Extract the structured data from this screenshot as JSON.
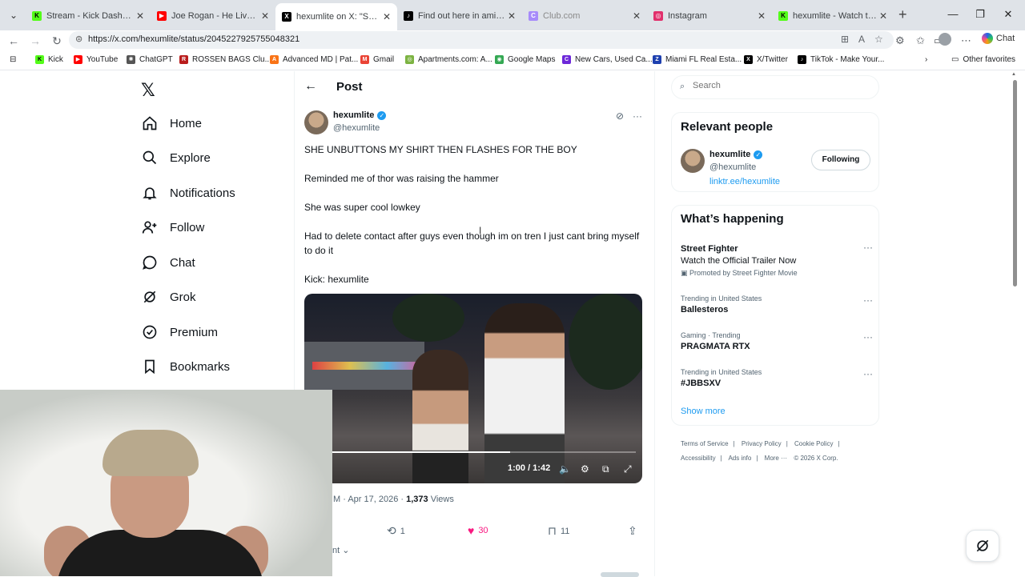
{
  "browser": {
    "tabs": [
      {
        "label": "Stream - Kick Dashboard",
        "fav_color": "#53fc18",
        "fav_text": "K"
      },
      {
        "label": "Joe Rogan - He Lived With N",
        "fav_color": "#ff0000",
        "fav_text": "▶"
      },
      {
        "label": "hexumlite on X: \"SHE UNBU",
        "fav_color": "#000000",
        "fav_text": "X",
        "active": true
      },
      {
        "label": "Find out here in amish doin",
        "fav_color": "#000000",
        "fav_text": "♪"
      },
      {
        "label": "Club.com",
        "fav_color": "#a78bfa",
        "fav_text": "C"
      },
      {
        "label": "Instagram",
        "fav_color": "#e1306c",
        "fav_text": "◎"
      },
      {
        "label": "hexumlite - Watch the VOD",
        "fav_color": "#53fc18",
        "fav_text": "K"
      }
    ],
    "url": "https://x.com/hexumlite/status/2045227925755048321",
    "chat_label": "Chat",
    "bookmarks": [
      {
        "label": "Kick",
        "color": "#53fc18",
        "glyph": "K"
      },
      {
        "label": "YouTube",
        "color": "#ff0000",
        "glyph": "▶"
      },
      {
        "label": "ChatGPT",
        "color": "#555555",
        "glyph": "✺"
      },
      {
        "label": "ROSSEN BAGS Clu...",
        "color": "#b91c1c",
        "glyph": "R"
      },
      {
        "label": "Advanced MD | Pat...",
        "color": "#f97316",
        "glyph": "A"
      },
      {
        "label": "Gmail",
        "color": "#ea4335",
        "glyph": "M"
      },
      {
        "label": "Apartments.com: A...",
        "color": "#7cb342",
        "glyph": "◎"
      },
      {
        "label": "Google Maps",
        "color": "#34a853",
        "glyph": "◉"
      },
      {
        "label": "New Cars, Used Ca...",
        "color": "#6d28d9",
        "glyph": "C"
      },
      {
        "label": "Miami FL Real Esta...",
        "color": "#1e40af",
        "glyph": "Z"
      },
      {
        "label": "X/Twitter",
        "color": "#000000",
        "glyph": "X"
      },
      {
        "label": "TikTok - Make Your...",
        "color": "#000000",
        "glyph": "♪"
      }
    ],
    "other_favorites": "Other favorites"
  },
  "nav": {
    "home": "Home",
    "explore": "Explore",
    "notifications": "Notifications",
    "follow": "Follow",
    "chat": "Chat",
    "grok": "Grok",
    "premium": "Premium",
    "bookmarks": "Bookmarks"
  },
  "post": {
    "header": "Post",
    "author_name": "hexumlite",
    "author_handle": "@hexumlite",
    "lines": [
      "SHE UNBUTTONS MY SHIRT THEN FLASHES FOR THE BOY",
      "Reminded me of thor was raising the hammer",
      "She was super cool lowkey",
      "Had to delete contact after guys even though im on tren I just cant bring myself to do it",
      "Kick: hexumlite"
    ],
    "video_time": "1:00 / 1:42",
    "video_progress": 0.59,
    "meta_prefix": "M · Apr 17, 2026 · ",
    "views_count": "1,373",
    "views_label": " Views",
    "retweets": "1",
    "likes": "30",
    "bookmarks": "11",
    "partial_reply": "nt"
  },
  "sidebar": {
    "search_placeholder": "Search",
    "relevant_title": "Relevant people",
    "person_name": "hexumlite",
    "person_handle": "@hexumlite",
    "person_link": "linktr.ee/hexumlite",
    "following_label": "Following",
    "happening_title": "What’s happening",
    "trends": [
      {
        "context": "",
        "title": "Street Fighter",
        "subtitle": "Watch the Official Trailer Now",
        "promo": "Promoted by Street Fighter Movie"
      },
      {
        "context": "Trending in United States",
        "title": "Ballesteros"
      },
      {
        "context": "Gaming · Trending",
        "title": "PRAGMATA RTX"
      },
      {
        "context": "Trending in United States",
        "title": "#JBBSXV"
      }
    ],
    "show_more": "Show more",
    "footer": [
      "Terms of Service",
      "|",
      "Privacy Policy",
      "|",
      "Cookie Policy",
      "|",
      "Accessibility",
      "|",
      "Ads info",
      "|",
      "More ···",
      "© 2026 X Corp."
    ]
  },
  "colors": {
    "accent": "#1d9bf0",
    "like": "#f91880"
  }
}
